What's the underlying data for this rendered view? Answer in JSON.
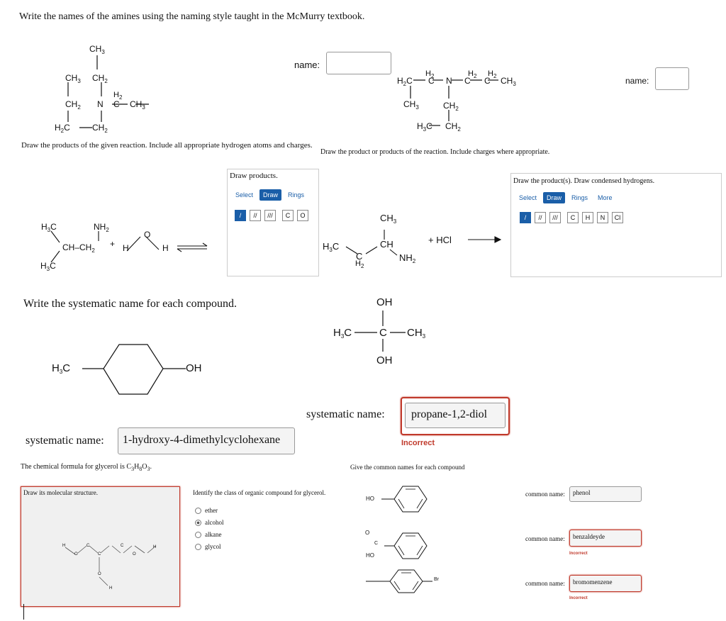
{
  "q1": {
    "prompt": "Write the names of the amines using the naming style taught in the McMurry textbook.",
    "name_label_1": "name:",
    "name_label_2": "name:"
  },
  "q2": {
    "left_prompt": "Draw the products of the given reaction. Include all appropriate hydrogen atoms and charges.",
    "right_prompt": "Draw the product or products of the reaction. Include charges where appropriate.",
    "left_panel_title": "Draw products.",
    "right_panel_title": "Draw the product(s). Draw condensed hydrogens.",
    "left_tabs": [
      "Select",
      "Draw",
      "Rings"
    ],
    "right_tabs": [
      "Select",
      "Draw",
      "Rings",
      "More"
    ],
    "left_atoms": [
      "C",
      "O"
    ],
    "right_atoms": [
      "C",
      "H",
      "N",
      "Cl"
    ],
    "plus_hcl": "+ HCl",
    "plus": "+"
  },
  "q3": {
    "prompt": "Write the systematic name for each compound.",
    "label": "systematic name:",
    "answer_left": "1-hydroxy-4-dimethylcyclohexane",
    "answer_right": "propane-1,2-diol",
    "incorrect": "Incorrect"
  },
  "q4": {
    "formula_prefix": "The chemical formula for glycerol is C",
    "formula_c": "3",
    "formula_h_label": "H",
    "formula_h": "8",
    "formula_o_label": "O",
    "formula_o": "3",
    "formula_end": ".",
    "draw_label": "Draw its molecular structure.",
    "identify_prompt": "Identify the class of organic compound for glycerol.",
    "options": [
      "ether",
      "alcohol",
      "alkane",
      "glycol"
    ],
    "selected": "alcohol"
  },
  "q5": {
    "prompt": "Give the common names for each compound",
    "label": "common name:",
    "answers": [
      "phenol",
      "benzaldeyde",
      "bromomenzene"
    ],
    "incorrect": "Incorrect"
  },
  "atoms": {
    "CH3": "CH",
    "CH2": "CH",
    "H2": "H",
    "N": "N",
    "H3C": "H",
    "H2C": "H",
    "C": "C",
    "NH2": "NH",
    "CH": "CH",
    "O": "O",
    "H": "H",
    "OH": "OH",
    "HO": "HO",
    "Br": "Br"
  }
}
